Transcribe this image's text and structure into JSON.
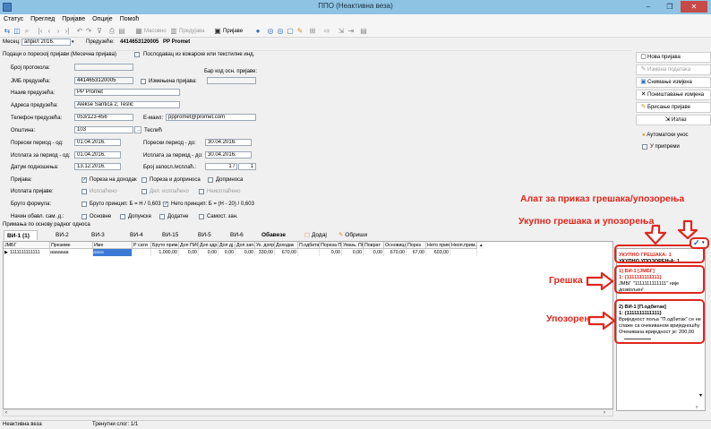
{
  "window": {
    "title": "ППО (Неактивна веза)",
    "minimize": "–",
    "maximize": "❐",
    "close": "✕"
  },
  "menu": [
    "Статус",
    "Преглед",
    "Пријаве",
    "Опције",
    "Помоћ"
  ],
  "toolbar": {
    "masovno": "Масовно",
    "predujava": "Предујава",
    "prijave": "Пријаве"
  },
  "month_bar": {
    "month_label": "Месец:",
    "month_value": "април 2016.",
    "predujava_label": "Предузеће:",
    "pib": "4414653120005",
    "company": "PP Promet"
  },
  "form": {
    "section_title": "Подаци о пореској пријави (Месечна пријава)",
    "leather_label": "Послодавац из кожарске или текстилне инд.",
    "protokol_label": "Број протокола:",
    "barcode_label": "Бар код осн. пријаве:",
    "jmb_label": "ЈМБ предузећа:",
    "jmb_value": "4414653120005",
    "changed_label": "Измењена пријава:",
    "name_label": "Назив предузећа:",
    "name_value": "PP Promet",
    "address_label": "Адреса предузећа:",
    "address_value": "Alekse Šantića 2, Teslić",
    "phone_label": "Телефон предузећа:",
    "phone_value": "053/123-456",
    "email_label": "Е-маил:",
    "email_value": "pppromet@promet.com",
    "municipality_label": "Општина:",
    "municipality_code": "103",
    "municipality_name": "Теслић",
    "tax_from_label": "Порески период - од:",
    "tax_from_value": "01.04.2016.",
    "tax_to_label": "Порески период - до:",
    "tax_to_value": "30.04.2016.",
    "pay_from_label": "Исплата за период - од:",
    "pay_from_value": "01.04.2016.",
    "pay_to_label": "Исплата за период - до:",
    "pay_to_value": "30.04.2016.",
    "submit_date_label": "Датум подношења:",
    "submit_date_value": "13.12.2016.",
    "employees_label": "Број запосл./исплаћ.:",
    "employees_value": "1 /",
    "employees_value2": "1",
    "prijava_label": "Пријава:",
    "cb_income_tax": "Пореза на доходак",
    "cb_tax_contrib": "Пореза и доприноса",
    "cb_contrib": "Доприноса",
    "payout_label": "Исплата пријаве:",
    "cb_paid": "Исплаћено",
    "cb_part_paid": "Дел. исплаћено",
    "cb_unpaid": "Неисплаћено",
    "gross_label": "Бруто формула:",
    "gross_principle": "Бруто принцип: Б = Н / 0,603",
    "net_principle": "Нето принцип: Б = (Н - 20) / 0,603",
    "calc_label": "Начин обавл. сам. д.:",
    "cb_main": "Основне",
    "cb_supplementary": "Допунске",
    "cb_additional": "Додатне",
    "cb_self": "Самост. зан."
  },
  "sidebar": [
    {
      "icon": "new-document-icon",
      "label": "Нова пријава"
    },
    {
      "icon": "edit-document-icon",
      "label": "Измена података"
    },
    {
      "icon": "save-icon",
      "label": "Снимање измјена"
    },
    {
      "icon": "cancel-icon",
      "label": "Поништавање измјена"
    },
    {
      "icon": "erase-icon",
      "label": "Брисање пријаве"
    },
    {
      "icon": "export-icon",
      "label": "Излаз"
    }
  ],
  "side_options": {
    "auto_entry": "Аутоматски унос",
    "in_preparation": "У припреми"
  },
  "receipts_label": "Примања по основу радног односа",
  "tabs": [
    {
      "label": "ВИ-1",
      "count": "(1)"
    },
    {
      "label": "ВИ-2"
    },
    {
      "label": "ВИ-3"
    },
    {
      "label": "ВИ-4"
    },
    {
      "label": "ВИ-15"
    },
    {
      "label": "ВИ-5"
    },
    {
      "label": "ВИ-6"
    },
    {
      "label": "Обавезе"
    }
  ],
  "tab_actions": {
    "add": "Додај",
    "delete": "Обриши"
  },
  "grid": {
    "columns": [
      "ЈМБГ",
      "Презиме",
      "Име",
      "Р сати",
      "Бруто прим.",
      "Доп ПИО",
      "Доп здр.",
      "Доп дј.",
      "Доп зап.",
      "Ук. допр.",
      "Доходак",
      "П.одбитак",
      "Пореза ПО",
      "Умањ. ПК",
      "Поврат",
      "Основица",
      "Порез",
      "Нето прим.",
      "Неоп.прим."
    ],
    "rows": [
      [
        "1111111111111",
        "aaaaaaa",
        "aaaa",
        "",
        "1.000,00",
        "0,00",
        "0,00",
        "0,00",
        "0,00",
        "330,00",
        "670,00",
        "",
        "0,00",
        "0,00",
        "0,00",
        "670,00",
        "67,00",
        "603,00",
        ""
      ]
    ]
  },
  "errors_panel": {
    "total_errors": "УКУПНО ГРЕШАКА: 1",
    "total_warnings": "УКУПНО УПОЗОРЕЊА: 1",
    "error_title": "1) ВИ-1 [ЈМБГ]",
    "error_ref": "1: {1111111111111}",
    "error_msg1": "ЈМБГ \"1111111111111\" није",
    "error_msg2": "дозвољен!",
    "warning_title": "2) ВИ-1 [П.одбитак]",
    "warning_ref": "1: {1111111111111}",
    "warning_msg1": "Вриједност поља \"П.одбитак\" се не",
    "warning_msg2": "слаже са очекиваном вриједношћу",
    "warning_msg3": "Очекивана вриједност је: 200,00"
  },
  "annotations": {
    "tool": "Алат за приказ грешака/упозорења",
    "total": "Укупно грешака и упозорења",
    "error": "Грешка",
    "warning": "Упозорење"
  },
  "status_bar": {
    "left": "Неактивна веза",
    "record": "Тренутни слог: 1/1"
  }
}
